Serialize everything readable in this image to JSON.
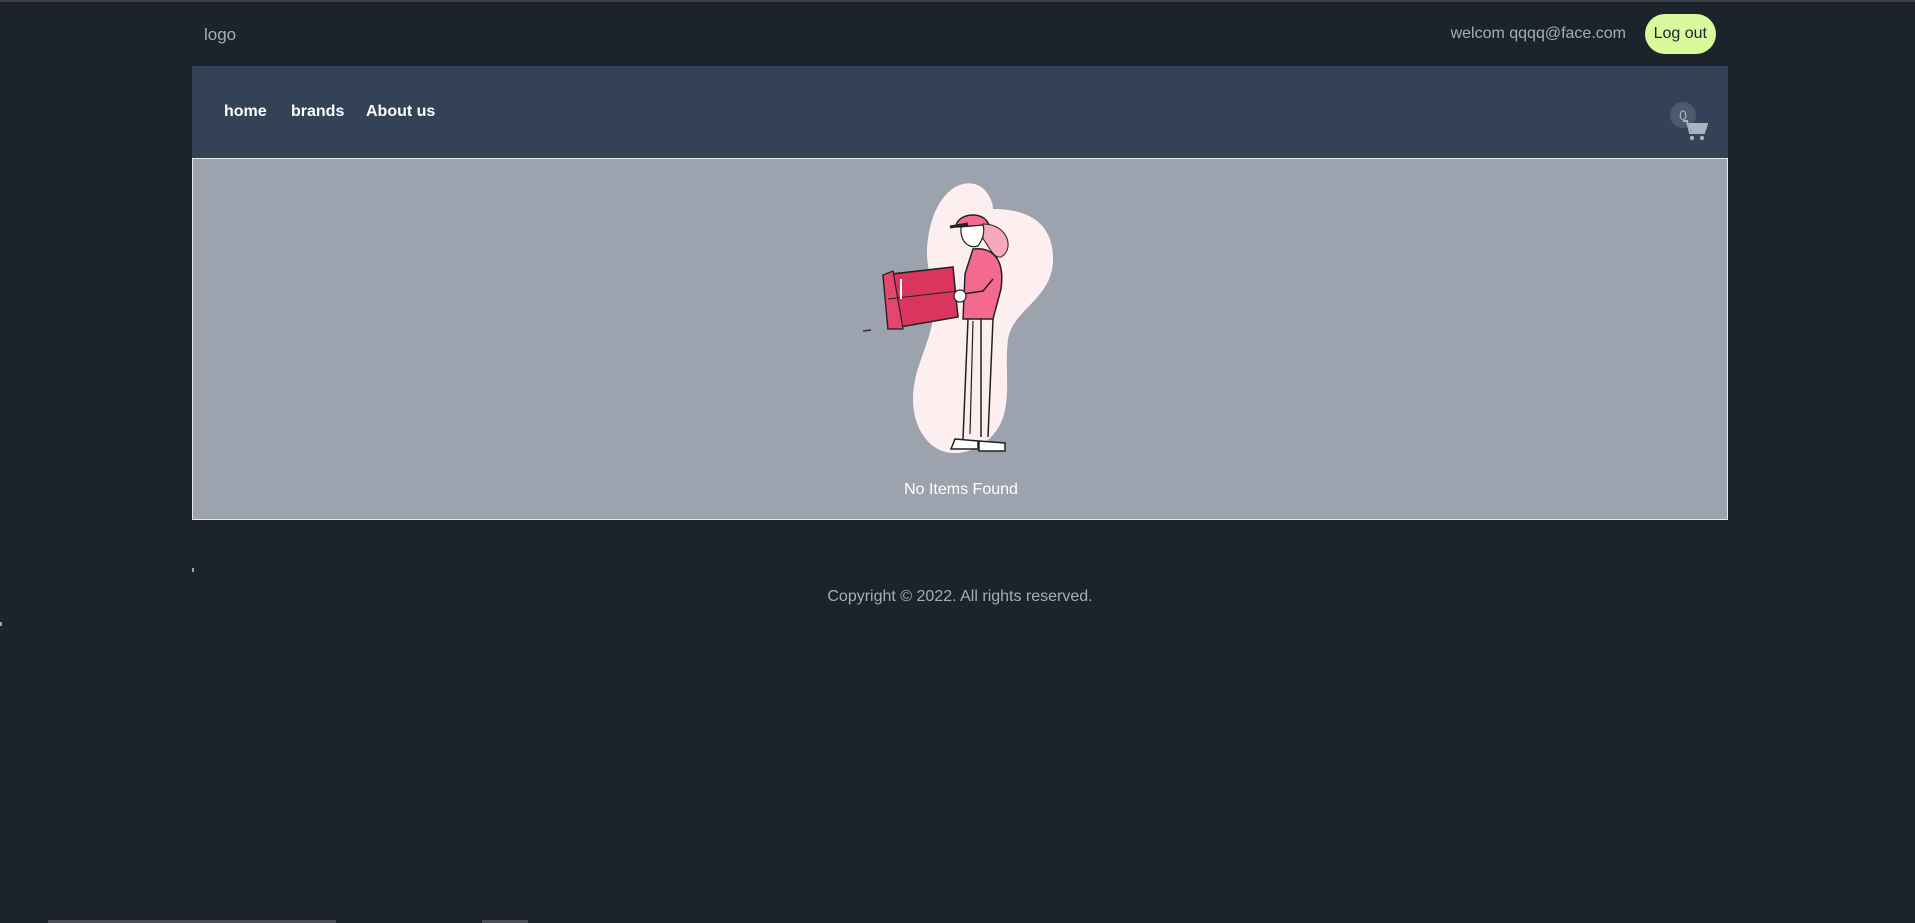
{
  "header": {
    "logo": "logo",
    "welcome": "welcom qqqq@face.com",
    "logout_label": "Log out"
  },
  "nav": {
    "items": [
      {
        "label": "home"
      },
      {
        "label": "brands"
      },
      {
        "label": "About us"
      }
    ],
    "cart_count": "0",
    "cart_icon": "cart-icon"
  },
  "content": {
    "empty_message": "No Items Found",
    "illustration": "delivery-person-with-box"
  },
  "footer": {
    "copyright": "Copyright © 2022. All rights reserved."
  },
  "colors": {
    "background": "#1d232b",
    "navbar": "#334256",
    "content": "#9ca3af",
    "logout_button": "#d9f99d",
    "accent_pink": "#d9355f"
  }
}
